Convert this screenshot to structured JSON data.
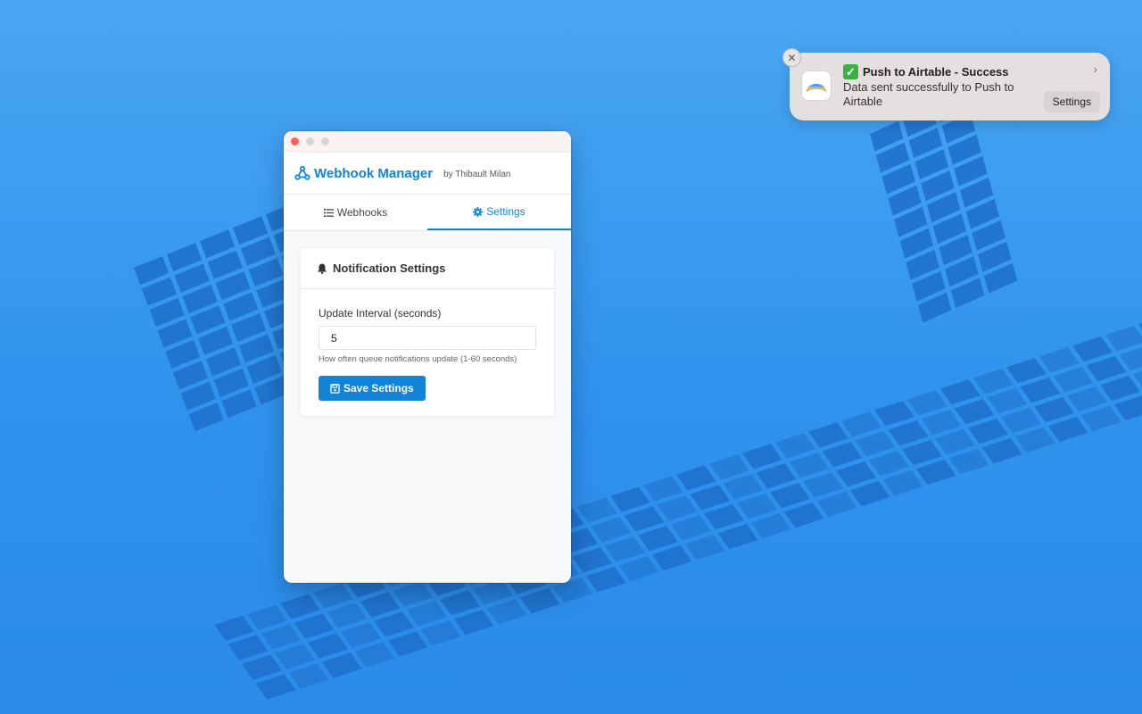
{
  "window": {
    "app_title": "Webhook Manager",
    "byline": "by Thibault Milan"
  },
  "tabs": [
    {
      "label": "Webhooks",
      "icon": "list-icon",
      "active": false
    },
    {
      "label": "Settings",
      "icon": "gear-icon",
      "active": true
    }
  ],
  "card": {
    "title": "Notification Settings",
    "icon": "bell-icon",
    "field_label": "Update Interval (seconds)",
    "field_value": "5",
    "help_text": "How often queue notifications update (1-60 seconds)",
    "save_label": "Save Settings"
  },
  "notification": {
    "title": "Push to Airtable - Success",
    "body": "Data sent successfully to Push to Airtable",
    "action_label": "Settings",
    "close_glyph": "✕",
    "chevron_glyph": "›"
  },
  "colors": {
    "accent": "#1184d8",
    "wallpaper": "#2f93ee",
    "success": "#3cb043"
  }
}
